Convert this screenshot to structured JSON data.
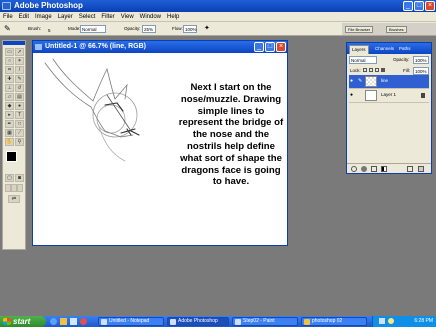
{
  "app": {
    "title": "Adobe Photoshop"
  },
  "menu": [
    "File",
    "Edit",
    "Image",
    "Layer",
    "Select",
    "Filter",
    "View",
    "Window",
    "Help"
  ],
  "options": {
    "brush_label": "Brush:",
    "brush_size": "5",
    "mode_label": "Mode:",
    "mode_value": "Normal",
    "opacity_label": "Opacity:",
    "opacity_value": "25%",
    "flow_label": "Flow:",
    "flow_value": "100%"
  },
  "palette_well": {
    "tabs": [
      "File Browser",
      "Brushes"
    ]
  },
  "document": {
    "title": "Untitled-1 @ 66.7% (line, RGB)",
    "text": "Next I start on the nose/muzzle. Drawing simple lines to represent the bridge of the nose and the nostrils help define what sort of shape the dragons face is going to have."
  },
  "layers_panel": {
    "tabs": [
      "Layers",
      "Channels",
      "Paths"
    ],
    "blend_mode": "Normal",
    "opacity_label": "Opacity:",
    "opacity_value": "100%",
    "lock_label": "Lock:",
    "fill_label": "Fill:",
    "fill_value": "100%",
    "layers": [
      {
        "name": "line",
        "selected": true
      },
      {
        "name": "Layer 1",
        "selected": false
      }
    ]
  },
  "taskbar": {
    "start_label": "start",
    "tasks": [
      "Untitled - Notepad",
      "Adobe Photoshop",
      "Step02 - Paint",
      "photoshop 02"
    ],
    "clock": "6:28 PM"
  }
}
